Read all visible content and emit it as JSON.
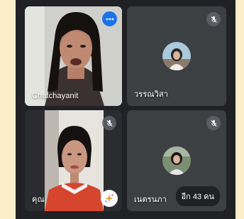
{
  "participants": [
    {
      "name": "Chatchayanit",
      "camera_on": true,
      "has_menu": true
    },
    {
      "name": "วรรณวิสา",
      "camera_on": false,
      "muted": true
    },
    {
      "name": "คุณ",
      "camera_on": true,
      "muted": true,
      "is_self": true
    },
    {
      "name": "เนตรนภา",
      "camera_on": false,
      "muted": true
    }
  ],
  "overflow": {
    "label": "อีก 43 คน"
  },
  "icons": {
    "mute": "mic-off-icon",
    "menu": "more-options-icon",
    "effects": "visual-effects-icon"
  },
  "colors": {
    "page_bg": "#fbeec9",
    "frame_bg": "#202124",
    "tile_bg": "#3c4043",
    "accent": "#1a73e8"
  }
}
